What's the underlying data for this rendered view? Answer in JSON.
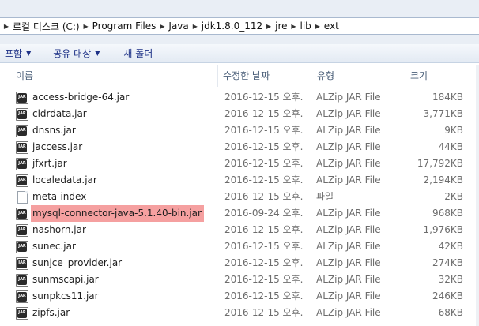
{
  "address_bar": {
    "breadcrumbs": [
      "로컬 디스크 (C:)",
      "Program Files",
      "Java",
      "jdk1.8.0_112",
      "jre",
      "lib",
      "ext"
    ]
  },
  "toolbar": {
    "organize_label": "포함",
    "share_label": "공유 대상",
    "new_folder_label": "새 폴더"
  },
  "columns": {
    "name": "이름",
    "date": "수정한 날짜",
    "type": "유형",
    "size": "크기"
  },
  "files": [
    {
      "name": "access-bridge-64.jar",
      "date": "2016-12-15 오후...",
      "type": "ALZip JAR File",
      "size": "184KB",
      "icon": "jar-icon",
      "highlighted": false
    },
    {
      "name": "cldrdata.jar",
      "date": "2016-12-15 오후...",
      "type": "ALZip JAR File",
      "size": "3,771KB",
      "icon": "jar-icon",
      "highlighted": false
    },
    {
      "name": "dnsns.jar",
      "date": "2016-12-15 오후...",
      "type": "ALZip JAR File",
      "size": "9KB",
      "icon": "jar-icon",
      "highlighted": false
    },
    {
      "name": "jaccess.jar",
      "date": "2016-12-15 오후...",
      "type": "ALZip JAR File",
      "size": "44KB",
      "icon": "jar-icon",
      "highlighted": false
    },
    {
      "name": "jfxrt.jar",
      "date": "2016-12-15 오후...",
      "type": "ALZip JAR File",
      "size": "17,792KB",
      "icon": "jar-icon",
      "highlighted": false
    },
    {
      "name": "localedata.jar",
      "date": "2016-12-15 오후...",
      "type": "ALZip JAR File",
      "size": "2,194KB",
      "icon": "jar-icon",
      "highlighted": false
    },
    {
      "name": "meta-index",
      "date": "2016-12-15 오후...",
      "type": "파일",
      "size": "2KB",
      "icon": "file-icon",
      "highlighted": false
    },
    {
      "name": "mysql-connector-java-5.1.40-bin.jar",
      "date": "2016-09-24 오후...",
      "type": "ALZip JAR File",
      "size": "968KB",
      "icon": "jar-icon",
      "highlighted": true
    },
    {
      "name": "nashorn.jar",
      "date": "2016-12-15 오후...",
      "type": "ALZip JAR File",
      "size": "1,976KB",
      "icon": "jar-icon",
      "highlighted": false
    },
    {
      "name": "sunec.jar",
      "date": "2016-12-15 오후...",
      "type": "ALZip JAR File",
      "size": "42KB",
      "icon": "jar-icon",
      "highlighted": false
    },
    {
      "name": "sunjce_provider.jar",
      "date": "2016-12-15 오후...",
      "type": "ALZip JAR File",
      "size": "274KB",
      "icon": "jar-icon",
      "highlighted": false
    },
    {
      "name": "sunmscapi.jar",
      "date": "2016-12-15 오후...",
      "type": "ALZip JAR File",
      "size": "32KB",
      "icon": "jar-icon",
      "highlighted": false
    },
    {
      "name": "sunpkcs11.jar",
      "date": "2016-12-15 오후...",
      "type": "ALZip JAR File",
      "size": "246KB",
      "icon": "jar-icon",
      "highlighted": false
    },
    {
      "name": "zipfs.jar",
      "date": "2016-12-15 오후...",
      "type": "ALZip JAR File",
      "size": "68KB",
      "icon": "jar-icon",
      "highlighted": false
    }
  ],
  "colors": {
    "highlight": "#f5a0a0",
    "toolbar_text": "#1e3287",
    "header_text": "#4c607a"
  }
}
